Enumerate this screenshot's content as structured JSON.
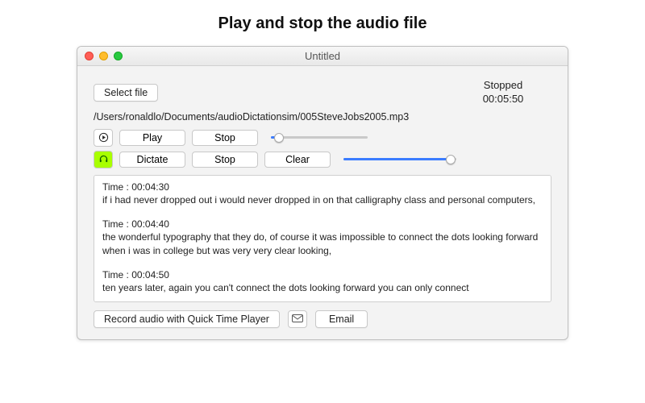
{
  "caption": "Play and stop the audio file",
  "window": {
    "title": "Untitled"
  },
  "select_file_label": "Select file",
  "status": {
    "state": "Stopped",
    "time": "00:05:50"
  },
  "filepath": "/Users/ronaldlo/Documents/audioDictationsim/005SteveJobs2005.mp3",
  "row1": {
    "icon": "play-circle-icon",
    "play_label": "Play",
    "stop_label": "Stop",
    "slider_pct": 8
  },
  "row2": {
    "icon": "headphones-icon",
    "dictate_label": "Dictate",
    "stop_label": "Stop",
    "clear_label": "Clear",
    "slider_pct": 95
  },
  "transcript": [
    {
      "time": "Time : 00:04:30",
      "text": "if i had never dropped out i would never dropped in on that calligraphy class and personal computers,"
    },
    {
      "time": "Time : 00:04:40",
      "text": "the wonderful typography that they do, of course it was impossible to connect the dots looking forward when i was in college but was very very clear looking,"
    },
    {
      "time": "Time : 00:04:50",
      "text": "ten years later, again you can't connect the dots looking forward you can only connect"
    }
  ],
  "bottom": {
    "record_label": "Record audio with Quick Time Player",
    "email_label": "Email"
  }
}
